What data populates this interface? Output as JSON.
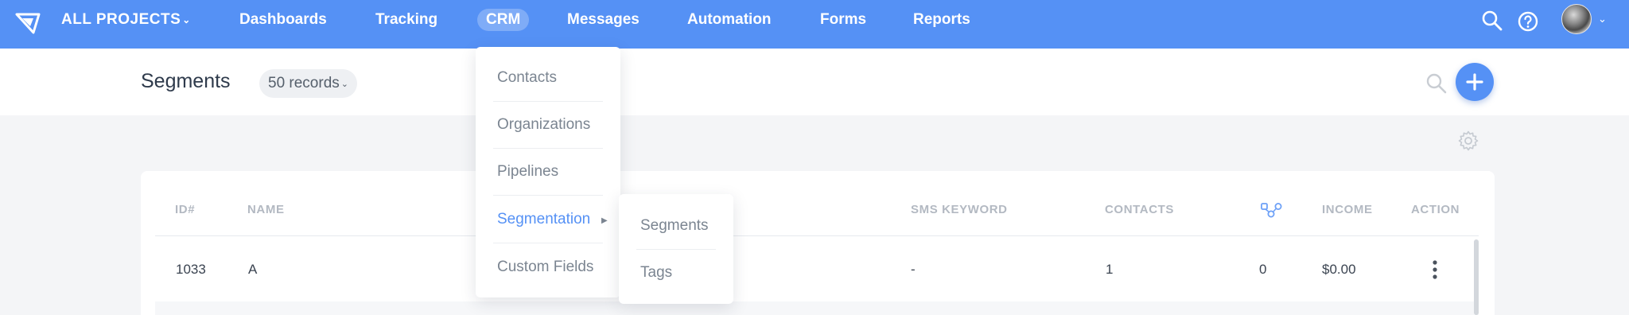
{
  "nav": {
    "project": "ALL PROJECTS",
    "items": [
      "Dashboards",
      "Tracking",
      "CRM",
      "Messages",
      "Automation",
      "Forms",
      "Reports"
    ],
    "active": "CRM",
    "icons": [
      "search-icon",
      "help-icon",
      "avatar"
    ]
  },
  "page": {
    "title": "Segments",
    "records": "50 records"
  },
  "crm_menu": {
    "items": [
      "Contacts",
      "Organizations",
      "Pipelines",
      "Segmentation",
      "Custom Fields"
    ],
    "active": "Segmentation",
    "submenu": [
      "Segments",
      "Tags"
    ]
  },
  "table": {
    "columns": [
      "ID#",
      "NAME",
      "SMS KEYWORD",
      "CONTACTS",
      "INCOME",
      "ACTION"
    ],
    "rows": [
      {
        "id": "1033",
        "name": "A",
        "sms_keyword": "-",
        "contacts": "1",
        "automations": "0",
        "income": "$0.00"
      }
    ]
  },
  "colors": {
    "accent": "#5591f5",
    "header_text": "#b3b9c2"
  }
}
